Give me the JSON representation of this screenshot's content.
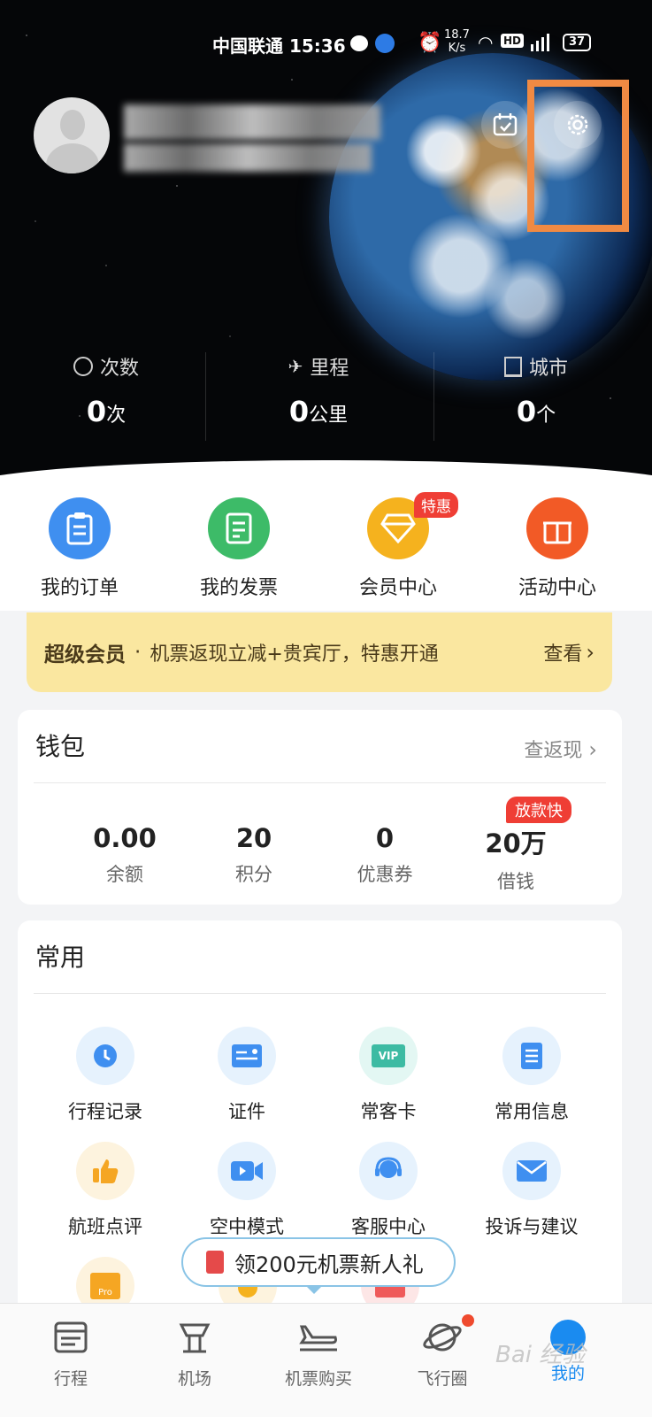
{
  "status_bar": {
    "carrier_time": "中国联通 15:36",
    "net_speed_top": "18.7",
    "net_speed_bottom": "K/s",
    "battery": "37"
  },
  "profile": {
    "name": "",
    "level": ""
  },
  "stats": [
    {
      "label": "次数",
      "value": "0",
      "unit": "次",
      "icon": "clock-icon"
    },
    {
      "label": "里程",
      "value": "0",
      "unit": "公里",
      "icon": "plane-icon"
    },
    {
      "label": "城市",
      "value": "0",
      "unit": "个",
      "icon": "building-icon"
    }
  ],
  "quick_actions": [
    {
      "label": "我的订单",
      "color": "#3f8ff0",
      "icon": "order-clipboard-icon"
    },
    {
      "label": "我的发票",
      "color": "#3dbb68",
      "icon": "invoice-icon"
    },
    {
      "label": "会员中心",
      "color": "#f5b21e",
      "icon": "diamond-icon",
      "tag": "特惠"
    },
    {
      "label": "活动中心",
      "color": "#f25a26",
      "icon": "gift-icon"
    }
  ],
  "banner": {
    "title": "超级会员",
    "dot": "·",
    "text": "机票返现立减+贵宾厅，特惠开通",
    "more": "查看"
  },
  "wallet": {
    "title": "钱包",
    "link": "查返现",
    "items": [
      {
        "value": "0.00",
        "label": "余额"
      },
      {
        "value": "20",
        "label": "积分"
      },
      {
        "value": "0",
        "label": "优惠券"
      },
      {
        "value": "20万",
        "label": "借钱",
        "tag": "放款快"
      }
    ]
  },
  "common": {
    "title": "常用",
    "items": [
      {
        "label": "行程记录",
        "icon": "clock-icon"
      },
      {
        "label": "证件",
        "icon": "id-card-icon"
      },
      {
        "label": "常客卡",
        "icon": "vip-card-icon",
        "icon_text": "VIP"
      },
      {
        "label": "常用信息",
        "icon": "document-icon"
      },
      {
        "label": "航班点评",
        "icon": "thumbs-up-icon"
      },
      {
        "label": "空中模式",
        "icon": "video-camera-icon"
      },
      {
        "label": "客服中心",
        "icon": "headset-icon"
      },
      {
        "label": "投诉与建议",
        "icon": "mail-icon"
      }
    ],
    "partial_icon_text": "Pro"
  },
  "promo": {
    "text": "领200元机票新人礼"
  },
  "nav": [
    {
      "label": "行程",
      "icon": "itinerary-icon"
    },
    {
      "label": "机场",
      "icon": "airport-tower-icon"
    },
    {
      "label": "机票购买",
      "icon": "plane-icon"
    },
    {
      "label": "飞行圈",
      "icon": "planet-icon"
    },
    {
      "label": "我的",
      "icon": "profile-icon"
    }
  ],
  "watermark": "Bai 经验"
}
